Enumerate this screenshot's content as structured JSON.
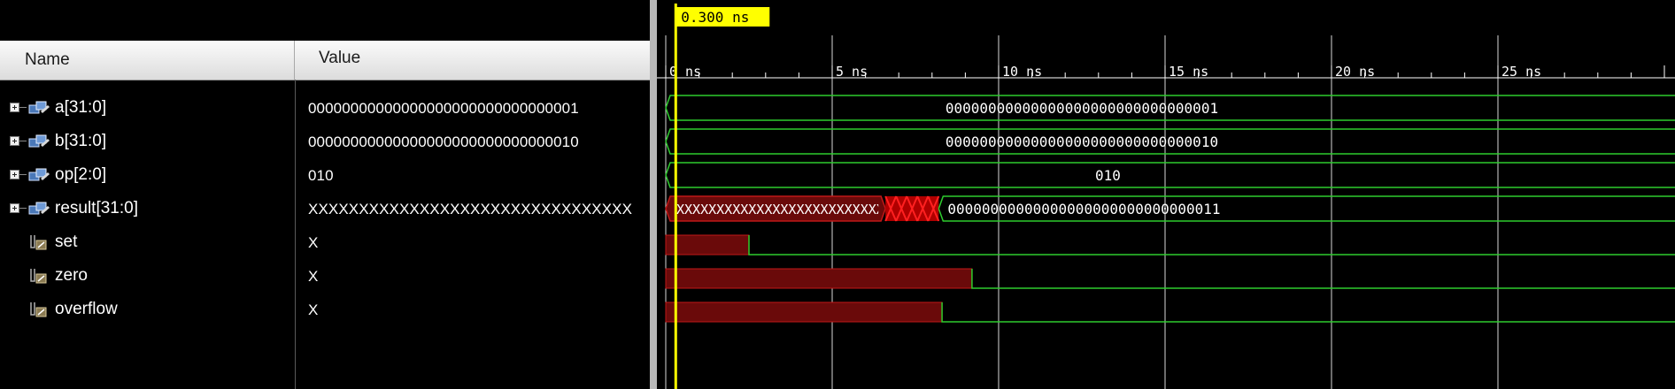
{
  "headers": {
    "name": "Name",
    "value": "Value"
  },
  "cursor": {
    "label": "0.300 ns",
    "time_ns": 0.3
  },
  "timeline": {
    "unit": "ns",
    "ticks": [
      {
        "label": "0 ns",
        "ns": 0
      },
      {
        "label": "5 ns",
        "ns": 5
      },
      {
        "label": "10 ns",
        "ns": 10
      },
      {
        "label": "15 ns",
        "ns": 15
      },
      {
        "label": "20 ns",
        "ns": 20
      },
      {
        "label": "25 ns",
        "ns": 25
      }
    ],
    "view_start_ns": -0.1,
    "view_end_ns": 30.9
  },
  "signals": [
    {
      "name": "a[31:0]",
      "value": "00000000000000000000000000000001",
      "type": "bus",
      "expandable": true,
      "wave": [
        {
          "kind": "bus",
          "from": 0,
          "to": 31,
          "label": "00000000000000000000000000000001"
        }
      ]
    },
    {
      "name": "b[31:0]",
      "value": "00000000000000000000000000000010",
      "type": "bus",
      "expandable": true,
      "wave": [
        {
          "kind": "bus",
          "from": 0,
          "to": 31,
          "label": "00000000000000000000000000000010"
        }
      ]
    },
    {
      "name": "op[2:0]",
      "value": "010",
      "type": "bus",
      "expandable": true,
      "wave": [
        {
          "kind": "bus",
          "from": 0,
          "to": 31,
          "label": "010"
        }
      ]
    },
    {
      "name": "result[31:0]",
      "value": "XXXXXXXXXXXXXXXXXXXXXXXXXXXXXXXX",
      "type": "bus",
      "expandable": true,
      "wave": [
        {
          "kind": "busx",
          "from": 0,
          "to": 6.6,
          "label": "XXXXXXXXXXXXXXXXXXXXXXXXXXXXXXXX"
        },
        {
          "kind": "glitch",
          "from": 6.6,
          "to": 8.2
        },
        {
          "kind": "bus",
          "from": 8.2,
          "to": 31,
          "label": "00000000000000000000000000000011"
        }
      ]
    },
    {
      "name": "set",
      "value": "X",
      "type": "wire",
      "expandable": false,
      "wave": [
        {
          "kind": "x",
          "from": 0,
          "to": 2.5
        },
        {
          "kind": "low",
          "from": 2.5,
          "to": 31
        }
      ]
    },
    {
      "name": "zero",
      "value": "X",
      "type": "wire",
      "expandable": false,
      "wave": [
        {
          "kind": "x",
          "from": 0,
          "to": 9.2
        },
        {
          "kind": "low",
          "from": 9.2,
          "to": 31
        }
      ]
    },
    {
      "name": "overflow",
      "value": "X",
      "type": "wire",
      "expandable": false,
      "wave": [
        {
          "kind": "x",
          "from": 0,
          "to": 8.3
        },
        {
          "kind": "low",
          "from": 8.3,
          "to": 31
        }
      ]
    }
  ],
  "colors": {
    "wave": "#2ecc2e",
    "x_fill": "#6a0a0a",
    "x_edge": "#c01818",
    "cursor": "#ffff00",
    "cursor_label_bg": "#ffff00",
    "grid": "#ffffff",
    "text": "#ffffff"
  }
}
